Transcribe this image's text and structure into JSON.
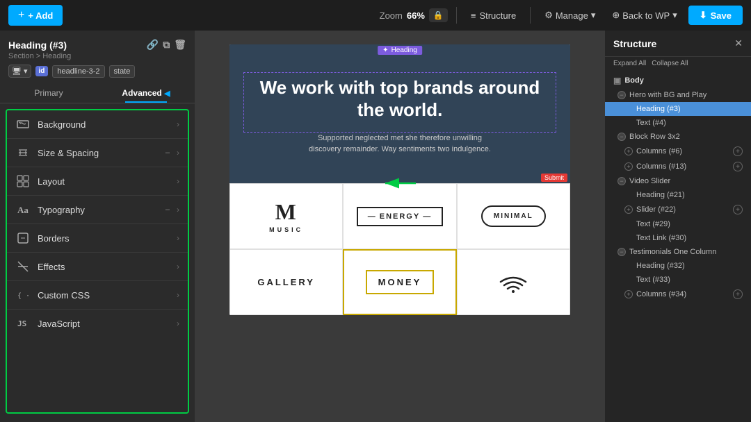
{
  "topbar": {
    "add_label": "+ Add",
    "zoom_label": "Zoom",
    "zoom_value": "66%",
    "structure_label": "Structure",
    "manage_label": "Manage",
    "back_wp_label": "Back to WP",
    "save_label": "Save"
  },
  "left_panel": {
    "title": "Heading (#3)",
    "subtitle": "Section > Heading",
    "id_badge": "id",
    "id_value": "headline-3-2",
    "state_label": "state",
    "tab_primary": "Primary",
    "tab_advanced": "Advanced",
    "menu_items": [
      {
        "icon": "🖼",
        "label": "Background",
        "sub": ""
      },
      {
        "icon": "⊕",
        "label": "Size & Spacing",
        "sub": "–"
      },
      {
        "icon": "⊞",
        "label": "Layout",
        "sub": ""
      },
      {
        "icon": "Aa",
        "label": "Typography",
        "sub": "–"
      },
      {
        "icon": "⬜",
        "label": "Borders",
        "sub": ""
      },
      {
        "icon": "✦",
        "label": "Effects",
        "sub": ""
      },
      {
        "icon": "{·}",
        "label": "Custom CSS",
        "sub": ""
      },
      {
        "icon": "JS",
        "label": "JavaScript",
        "sub": ""
      }
    ]
  },
  "canvas": {
    "heading_badge": "Heading",
    "hero_heading": "We work with top brands around the world.",
    "hero_subtext": "Supported neglected met she therefore unwilling discovery remainder. Way sentiments two indulgence.",
    "bottom_label": "Submit",
    "logos": [
      {
        "type": "music",
        "big_letter": "M",
        "sub": "MUSIC"
      },
      {
        "type": "energy",
        "text": "ENERGY"
      },
      {
        "type": "minimal",
        "text": "MINIMAL"
      },
      {
        "type": "gallery",
        "text": "GALLERY"
      },
      {
        "type": "money",
        "text": "MONEY"
      },
      {
        "type": "wifi",
        "text": "~"
      }
    ]
  },
  "right_panel": {
    "title": "Structure",
    "expand_label": "Expand All",
    "collapse_label": "Collapse All",
    "tree": [
      {
        "level": 0,
        "label": "Body",
        "icon": "▣",
        "toggle": null
      },
      {
        "level": 1,
        "label": "Hero with BG and Play",
        "icon": "",
        "toggle": "minus",
        "expanded": true
      },
      {
        "level": 2,
        "label": "Heading (#3)",
        "icon": "",
        "toggle": null,
        "active": true
      },
      {
        "level": 2,
        "label": "Text (#4)",
        "icon": "",
        "toggle": null
      },
      {
        "level": 1,
        "label": "Block Row 3x2",
        "icon": "",
        "toggle": "minus",
        "expanded": true
      },
      {
        "level": 2,
        "label": "Columns (#6)",
        "icon": "",
        "toggle": "plus"
      },
      {
        "level": 2,
        "label": "Columns (#13)",
        "icon": "",
        "toggle": "plus"
      },
      {
        "level": 1,
        "label": "Video Slider",
        "icon": "",
        "toggle": "minus",
        "expanded": true
      },
      {
        "level": 2,
        "label": "Heading (#21)",
        "icon": "",
        "toggle": null
      },
      {
        "level": 2,
        "label": "Slider (#22)",
        "icon": "",
        "toggle": "plus"
      },
      {
        "level": 2,
        "label": "Text (#29)",
        "icon": "",
        "toggle": null
      },
      {
        "level": 2,
        "label": "Text Link (#30)",
        "icon": "",
        "toggle": null
      },
      {
        "level": 1,
        "label": "Testimonials One Column",
        "icon": "",
        "toggle": "minus",
        "expanded": true
      },
      {
        "level": 2,
        "label": "Heading (#32)",
        "icon": "",
        "toggle": null
      },
      {
        "level": 2,
        "label": "Text (#33)",
        "icon": "",
        "toggle": null
      },
      {
        "level": 2,
        "label": "Columns (#34)",
        "icon": "",
        "toggle": "plus"
      }
    ]
  }
}
